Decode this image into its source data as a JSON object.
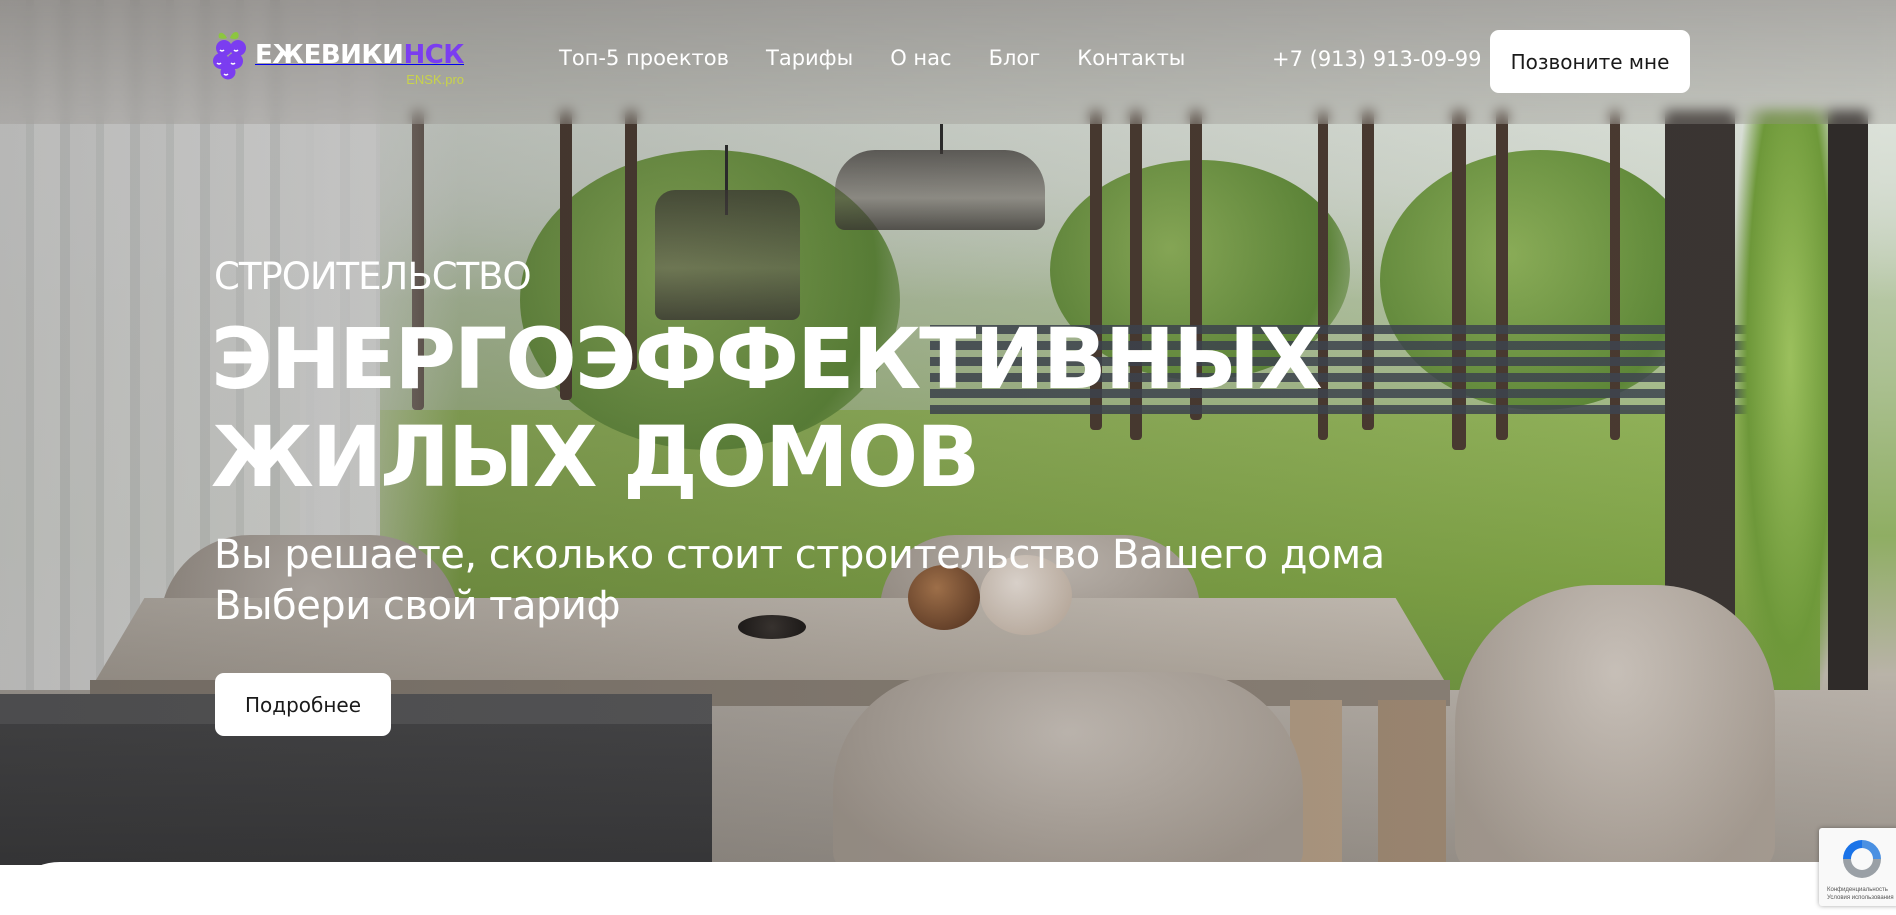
{
  "brand": {
    "name_main": "ЕЖЕВИКИ",
    "name_accent": "НСК",
    "sub": "ENSK.pro",
    "colors": {
      "accent": "#7b3df0",
      "leaf": "#8cc63f",
      "sub": "#c8d34a"
    }
  },
  "nav": {
    "items": [
      {
        "label": "Топ-5 проектов"
      },
      {
        "label": "Тарифы"
      },
      {
        "label": "О нас"
      },
      {
        "label": "Блог"
      },
      {
        "label": "Контакты"
      }
    ]
  },
  "header": {
    "phone": "+7 (913) 913-09-99",
    "call_label": "Позвоните мне"
  },
  "hero": {
    "eyebrow": "СТРОИТЕЛЬСТВО",
    "title_line1": "ЭНЕРГОЭФФЕКТИВНЫХ",
    "title_line2": "ЖИЛЫХ ДОМОВ",
    "sub_line1": "Вы решаете, сколько стоит строительство Вашего дома",
    "sub_line2": "Выбери свой тариф",
    "cta_label": "Подробнее"
  },
  "recaptcha": {
    "line1": "Конфиденциальность",
    "line2": "Условия использования"
  }
}
